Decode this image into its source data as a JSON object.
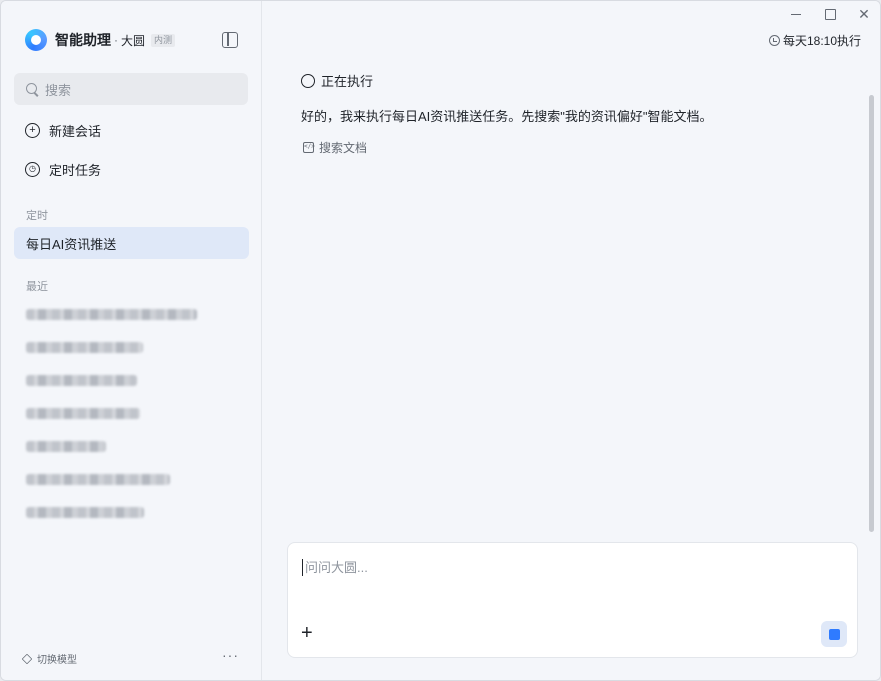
{
  "sidebar": {
    "brand": {
      "name": "智能助理",
      "separator": "·",
      "sub": "大圆",
      "badge": "内测"
    },
    "search": {
      "placeholder": "搜索"
    },
    "nav": [
      {
        "label": "新建会话",
        "icon": "plus-circle-icon"
      },
      {
        "label": "定时任务",
        "icon": "clock-icon"
      }
    ],
    "sections": {
      "scheduled": "定时",
      "recent": "最近"
    },
    "scheduled_items": [
      "每日AI资讯推送"
    ],
    "footer": {
      "switch_model": "切换模型",
      "more": "···"
    }
  },
  "main": {
    "schedule": "每天18:10执行",
    "status": "正在执行",
    "message": "好的，我来执行每日AI资讯推送任务。先搜索\"我的资讯偏好\"智能文档。",
    "tool": "搜索文档",
    "composer": {
      "placeholder": "问问大圆..."
    }
  },
  "colors": {
    "accent": "#2f7bff",
    "active_bg": "#dfe8f8"
  }
}
